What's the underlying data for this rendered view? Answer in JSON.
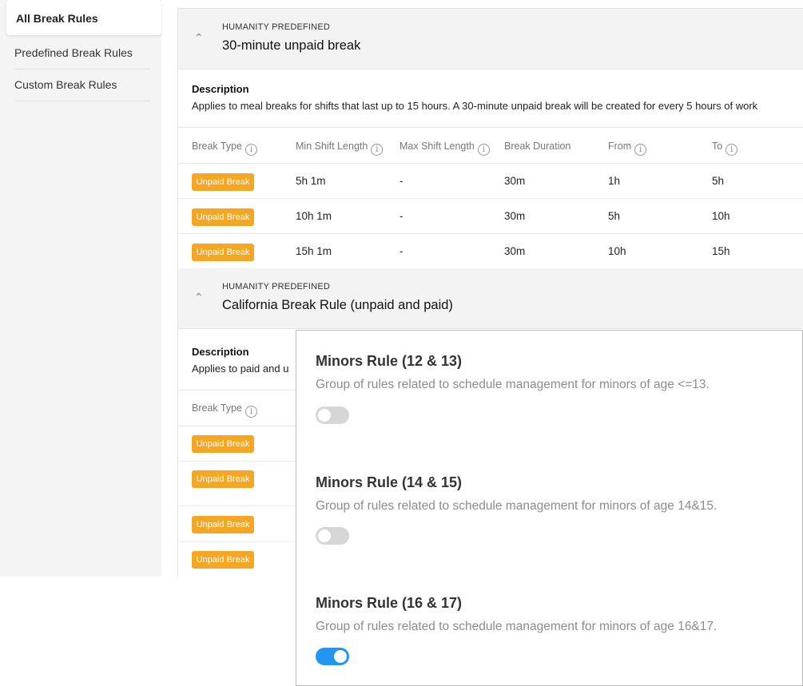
{
  "sidebar": {
    "items": [
      {
        "label": "All Break Rules",
        "active": true
      },
      {
        "label": "Predefined Break Rules"
      },
      {
        "label": "Custom Break Rules"
      }
    ]
  },
  "sections": [
    {
      "predefined_label": "HUMANITY PREDEFINED",
      "title": "30-minute unpaid break",
      "description_heading": "Description",
      "description_text": "Applies to meal breaks for shifts that last up to 15 hours. A 30-minute unpaid break will be created for every 5 hours of work",
      "columns": [
        "Break Type",
        "Min Shift Length",
        "Max Shift Length",
        "Break Duration",
        "From",
        "To"
      ],
      "rows": [
        {
          "type": "Unpaid Break",
          "min": "5h 1m",
          "max": "-",
          "duration": "30m",
          "from": "1h",
          "to": "5h"
        },
        {
          "type": "Unpaid Break",
          "min": "10h 1m",
          "max": "-",
          "duration": "30m",
          "from": "5h",
          "to": "10h"
        },
        {
          "type": "Unpaid Break",
          "min": "15h 1m",
          "max": "-",
          "duration": "30m",
          "from": "10h",
          "to": "15h"
        }
      ]
    },
    {
      "predefined_label": "HUMANITY PREDEFINED",
      "title": "California Break Rule (unpaid and paid)",
      "description_heading": "Description",
      "description_text": "Applies to paid and u",
      "columns": [
        "Break Type"
      ],
      "rows": [
        {
          "type": "Unpaid Break"
        },
        {
          "type": "Unpaid Break"
        },
        {
          "type": "Unpaid Break"
        },
        {
          "type": "Unpaid Break"
        }
      ]
    }
  ],
  "overlay": {
    "rules": [
      {
        "title": "Minors Rule (12 & 13)",
        "description": "Group of rules related to schedule management for minors of age <=13.",
        "enabled": false
      },
      {
        "title": "Minors Rule (14 & 15)",
        "description": "Group of rules related to schedule management for minors of age 14&15.",
        "enabled": false
      },
      {
        "title": "Minors Rule (16 & 17)",
        "description": "Group of rules related to schedule management for minors of age 16&17.",
        "enabled": true
      }
    ]
  },
  "colors": {
    "badge": "#f5a623",
    "toggle_on": "#2196f3",
    "toggle_off": "#d6d6d6"
  }
}
